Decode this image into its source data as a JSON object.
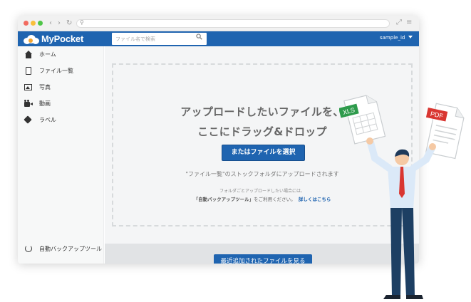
{
  "app": {
    "logo_text": "MyPocket",
    "brand_color": "#1f64b0"
  },
  "header": {
    "search_placeholder": "ファイル名で検索",
    "user": "sample_id"
  },
  "icons": {
    "search": "search-icon",
    "home": "home-icon",
    "file": "file-icon",
    "photo": "photo-icon",
    "video": "video-icon",
    "tag": "tag-icon",
    "sync": "sync-icon"
  },
  "sidebar": {
    "items": [
      {
        "label": "ホーム"
      },
      {
        "label": "ファイル一覧"
      },
      {
        "label": "写真"
      },
      {
        "label": "動画"
      },
      {
        "label": "ラベル"
      }
    ],
    "backup_tool": "自動バックアップツール"
  },
  "dropzone": {
    "title_line1": "アップロードしたいファイルを、",
    "title_line2": "ここにドラッグ&ドロップ",
    "select_button": "またはファイルを選択",
    "note": "\"ファイル一覧\"のストックフォルダにアップロードされます",
    "small_line1": "フォルダごとアップロードしたい場合には、",
    "small_tool_name": "「自動バックアップツール」",
    "small_line2_rest": "をご利用ください。",
    "details_link": "詳しくはこちら"
  },
  "recent_button": "最近追加されたファイルを見る",
  "illustration": {
    "xls_label": "XLS",
    "pdf_label": "PDF",
    "xls_color": "#2e9b4c",
    "pdf_color": "#d93631"
  }
}
